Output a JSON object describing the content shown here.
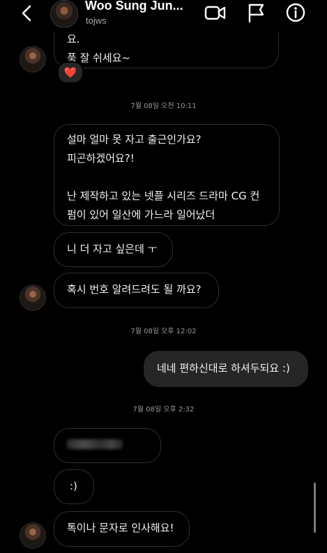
{
  "header": {
    "name": "Woo Sung Jun...",
    "username": "tojws",
    "icons": {
      "back": "chevron-left-icon",
      "video": "video-camera-icon",
      "report": "flag-icon",
      "info": "info-icon"
    }
  },
  "messages": [
    {
      "id": "m1",
      "from": "them",
      "text": "요.\n푹 잘 쉬세요~",
      "reaction": "❤️"
    },
    {
      "id": "m2",
      "from": "them",
      "text": "설마 얼마 못 자고 출근인가요?\n피곤하겠어요?!\n\n난 제작하고 있는 넷플 시리즈 드라마 CG 컨\n펌이 있어 일산에 가느라 일어났더"
    },
    {
      "id": "m3",
      "from": "them",
      "text": "니 더 자고 싶은데 ㅜ"
    },
    {
      "id": "m4",
      "from": "them",
      "text": "혹시 번호 알려드려도 될 까요?"
    },
    {
      "id": "m5",
      "from": "me",
      "text": "네네 편하신대로 하셔두되요 :)"
    },
    {
      "id": "m6",
      "from": "them",
      "text": ""
    },
    {
      "id": "m7",
      "from": "them",
      "text": ":)"
    },
    {
      "id": "m8",
      "from": "them",
      "text": "톡이나 문자로 인사해요!"
    }
  ],
  "timestamps": [
    "7월 08일 오전 10:11",
    "7월 08일 오후 12:02",
    "7월 08일 오후 2:32"
  ],
  "colors": {
    "background": "#000000",
    "incoming_border": "#2f2f2f",
    "outgoing_bubble": "#262626",
    "text": "#f2f2f2",
    "muted": "#9a9a9a",
    "heart": "#ff3040"
  }
}
